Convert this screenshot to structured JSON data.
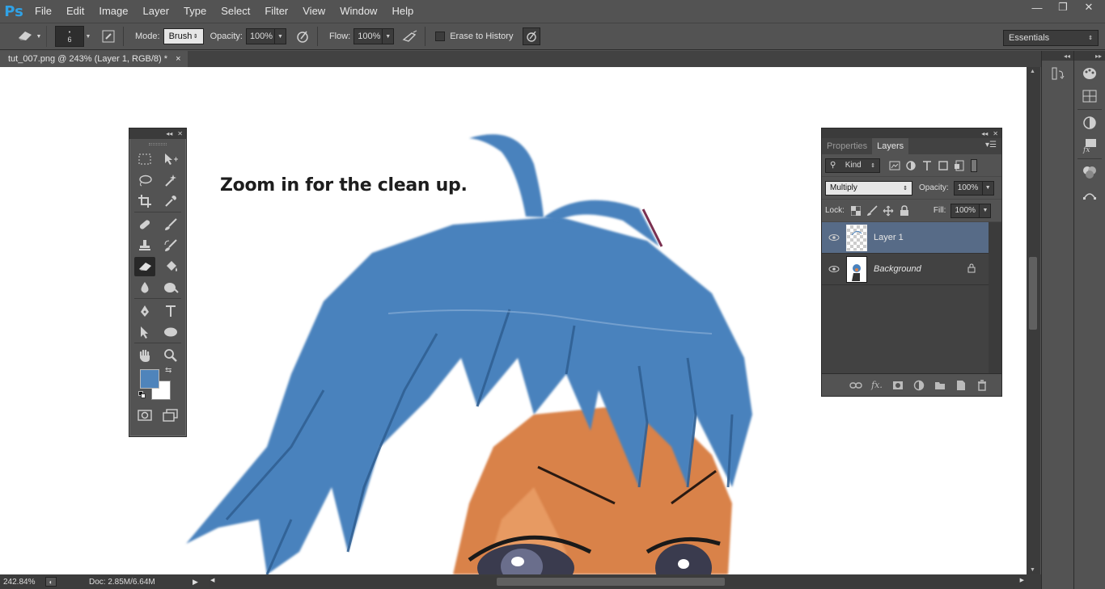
{
  "app": {
    "logo": "Ps"
  },
  "menu": [
    "File",
    "Edit",
    "Image",
    "Layer",
    "Type",
    "Select",
    "Filter",
    "View",
    "Window",
    "Help"
  ],
  "window_controls": {
    "minimize": "—",
    "restore": "❐",
    "close": "✕"
  },
  "options_bar": {
    "brush_size": "6",
    "mode_label": "Mode:",
    "mode_value": "Brush",
    "opacity_label": "Opacity:",
    "opacity_value": "100%",
    "flow_label": "Flow:",
    "flow_value": "100%",
    "erase_history_label": "Erase to History",
    "workspace": "Essentials"
  },
  "document": {
    "tab_title": "tut_007.png @ 243% (Layer 1, RGB/8) *",
    "close": "×",
    "caption": "Zoom in for the clean up."
  },
  "status": {
    "zoom": "242.84%",
    "doc_info": "Doc: 2.85M/6.64M"
  },
  "colors": {
    "foreground": "#4f84bb",
    "background": "#ffffff",
    "hair_blue": "#4a82bd",
    "hair_dark": "#2f5e91",
    "skin": "#d9824a",
    "layer_selected": "#576b87",
    "ps_blue": "#30a2e6"
  },
  "layers_panel": {
    "tabs": [
      "Properties",
      "Layers"
    ],
    "active_tab": "Layers",
    "kind_label": "Kind",
    "blend_mode": "Multiply",
    "opacity_label": "Opacity:",
    "opacity_value": "100%",
    "lock_label": "Lock:",
    "fill_label": "Fill:",
    "fill_value": "100%",
    "layers": [
      {
        "name": "Layer 1",
        "selected": true,
        "visible": true
      },
      {
        "name": "Background",
        "selected": false,
        "visible": true,
        "locked": true
      }
    ]
  },
  "tools": [
    [
      "marquee-icon",
      "move-icon"
    ],
    [
      "lasso-icon",
      "magic-wand-icon"
    ],
    [
      "crop-icon",
      "eyedropper-icon"
    ],
    [
      "healing-brush-icon",
      "brush-icon"
    ],
    [
      "clone-stamp-icon",
      "history-brush-icon"
    ],
    [
      "eraser-icon",
      "paint-bucket-icon"
    ],
    [
      "blur-icon",
      "dodge-icon"
    ],
    [
      "pen-icon",
      "type-icon"
    ],
    [
      "path-select-icon",
      "ellipse-icon"
    ],
    [
      "hand-icon",
      "zoom-icon"
    ]
  ],
  "active_tool": "eraser-icon"
}
